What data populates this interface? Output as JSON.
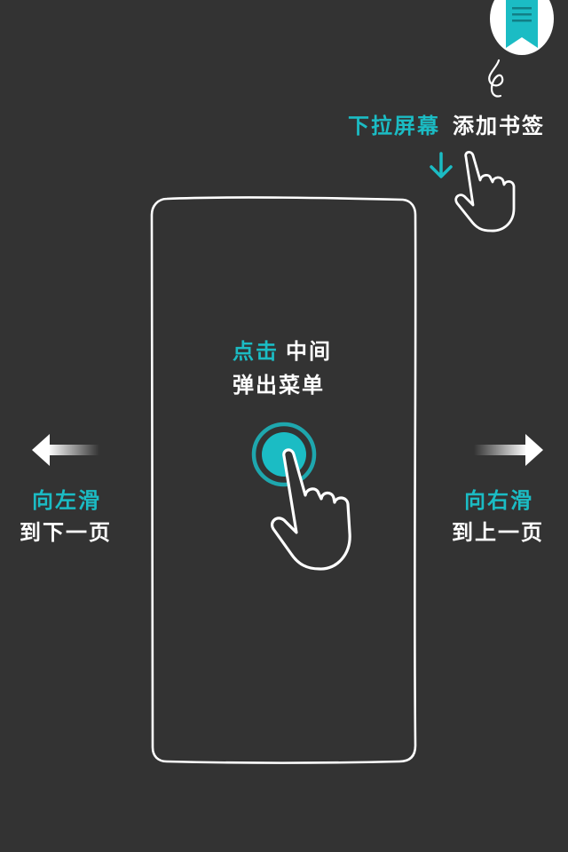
{
  "bookmark_hint": {
    "highlight": "下拉屏幕",
    "rest": "添加书签"
  },
  "center_hint": {
    "highlight": "点击",
    "line1_rest": "中间",
    "line2": "弹出菜单"
  },
  "left_hint": {
    "line1": "向左滑",
    "line2": "到下一页"
  },
  "right_hint": {
    "line1": "向右滑",
    "line2": "到上一页"
  },
  "icons": [
    "bookmark-icon",
    "swipe-down-arrow-icon",
    "hand-pointer-icon",
    "tap-circle-icon",
    "arrow-left-icon",
    "arrow-right-icon",
    "phone-outline"
  ],
  "colors": {
    "background": "#333333",
    "accent": "#1BBCC4",
    "text": "#FFFFFF"
  }
}
